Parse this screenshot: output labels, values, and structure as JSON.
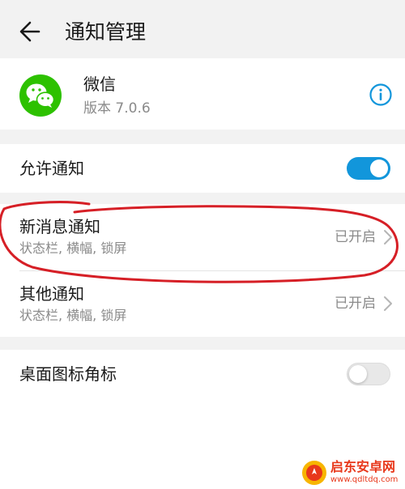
{
  "header": {
    "back_icon": "arrow-left-icon",
    "title": "通知管理"
  },
  "app": {
    "icon": "wechat-logo-icon",
    "name": "微信",
    "version": "版本 7.0.6",
    "info_icon": "info-icon"
  },
  "allow_notifications": {
    "label": "允许通知",
    "enabled": true
  },
  "channels": [
    {
      "label": "新消息通知",
      "detail": "状态栏, 横幅, 锁屏",
      "status": "已开启"
    },
    {
      "label": "其他通知",
      "detail": "状态栏, 横幅, 锁屏",
      "status": "已开启"
    }
  ],
  "badge": {
    "label": "桌面图标角标",
    "enabled": false
  },
  "watermark": {
    "name": "启东安卓网",
    "url": "www.qdltdq.com"
  },
  "colors": {
    "accent": "#1296db",
    "wechat_green": "#2dc100",
    "annotation_red": "#d61f26"
  }
}
